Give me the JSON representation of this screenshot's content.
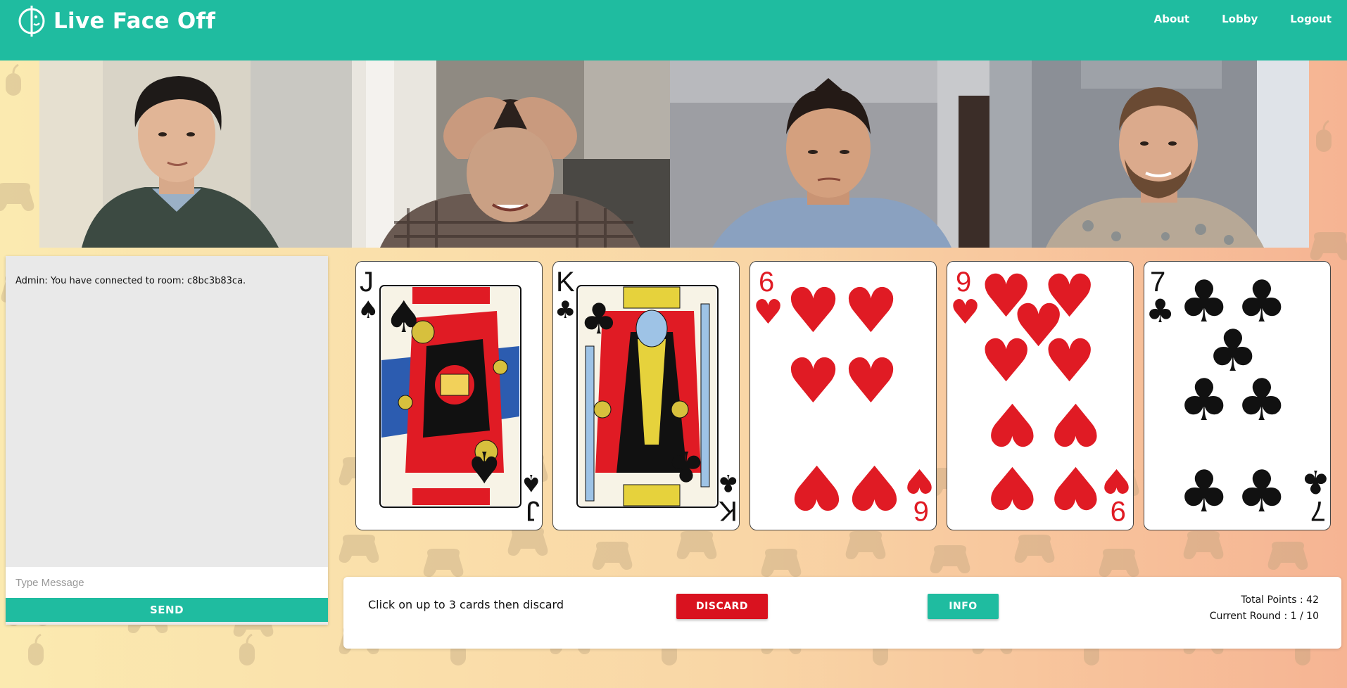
{
  "brand": {
    "title": "Live Face Off"
  },
  "nav": {
    "links": [
      "About",
      "Lobby",
      "Logout"
    ]
  },
  "colors": {
    "teal": "#1fbca0",
    "red": "#d9121f"
  },
  "chat": {
    "messages": [
      "Admin: You have connected to room: c8bc3b83ca."
    ],
    "input_placeholder": "Type Message",
    "input_value": "",
    "send_label": "SEND"
  },
  "hand": {
    "cards": [
      {
        "rank": "J",
        "suit": "spades",
        "suit_symbol": "♠",
        "color": "black"
      },
      {
        "rank": "K",
        "suit": "clubs",
        "suit_symbol": "♣",
        "color": "black"
      },
      {
        "rank": "6",
        "suit": "hearts",
        "suit_symbol": "♥",
        "color": "red"
      },
      {
        "rank": "9",
        "suit": "hearts",
        "suit_symbol": "♥",
        "color": "red"
      },
      {
        "rank": "7",
        "suit": "clubs",
        "suit_symbol": "♣",
        "color": "black"
      }
    ]
  },
  "panel": {
    "instruction": "Click on up to 3 cards then discard",
    "discard_label": "DISCARD",
    "info_label": "INFO",
    "total_points": "Total Points : 42",
    "current_round": "Current Round : 1 / 10"
  },
  "video": {
    "participant_count": 4
  }
}
